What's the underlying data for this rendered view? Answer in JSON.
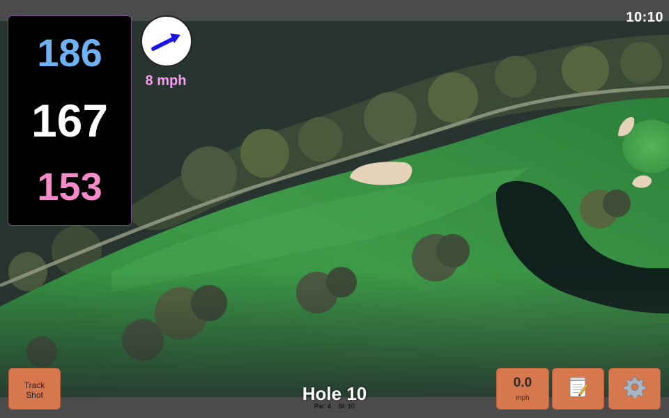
{
  "status_bar": {
    "time": "10:10"
  },
  "distances": {
    "back": "186",
    "middle": "167",
    "front": "153",
    "colors": {
      "back": "#6fb2f3",
      "middle": "#ffffff",
      "front": "#f58ac8"
    }
  },
  "wind": {
    "speed_label": "8 mph",
    "direction_icon": "arrow-icon"
  },
  "hole": {
    "title": "Hole 10",
    "par": "Par: 4",
    "stroke_index": "SI: 10"
  },
  "buttons": {
    "track_shot_line1": "Track",
    "track_shot_line2": "Shot",
    "speed_value": "0.0",
    "speed_unit": "mph",
    "notes_icon": "notepad-icon",
    "settings_icon": "gear-icon"
  },
  "colors": {
    "button_bg": "#d7774d",
    "panel_bg": "#000000",
    "wind_label": "#ff9cf2",
    "bar_bg": "#4b4b4b"
  }
}
